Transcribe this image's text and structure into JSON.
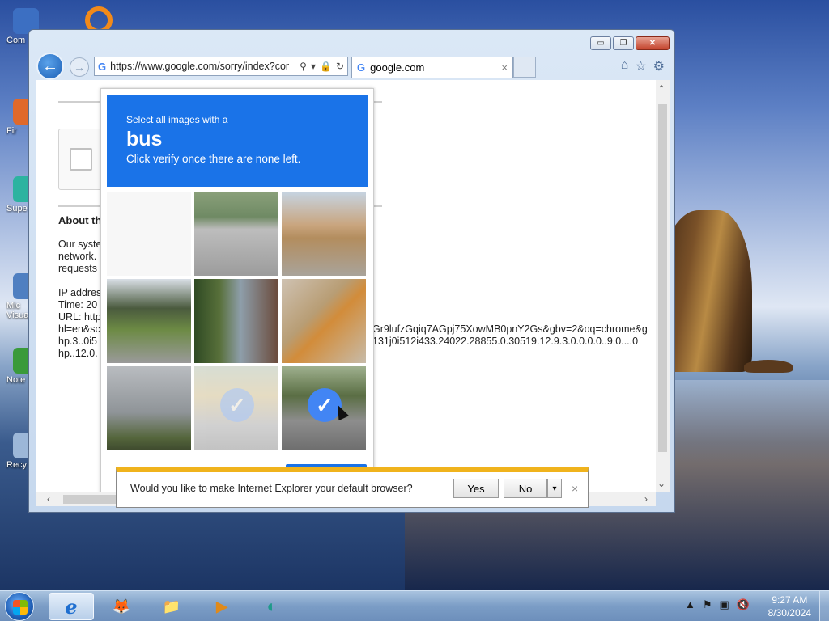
{
  "desktop": {
    "icons": [
      {
        "label": "Com",
        "color": "#3c6fc2"
      },
      {
        "label": "Fir",
        "color": "#e0692a"
      },
      {
        "label": "Supe",
        "color": "#2cb3a0"
      },
      {
        "label": "Mic Visua",
        "color": "#4f7fc1"
      },
      {
        "label": "Note",
        "color": "#3a9a3a"
      },
      {
        "label": "Recy",
        "color": "#9cb7d8"
      }
    ]
  },
  "browser": {
    "address_url": "https://www.google.com/sorry/index?cor",
    "address_g": "G",
    "tab_title": "google.com",
    "tab_g": "G",
    "tab_close": "×",
    "back_glyph": "←",
    "fwd_glyph": "→",
    "controls": {
      "minimize": "▭",
      "restore": "❐",
      "close": "✕"
    }
  },
  "page": {
    "about_heading": "About th",
    "lines": [
      "Our syste",
      "network.",
      "requests",
      "",
      "IP addres",
      "Time: 20",
      "URL: http",
      "hl=en&sc",
      "hp.3..0i5",
      "hp..12.0."
    ],
    "url_tail_1": "Gr9lufzGqiq7AGpj75XowMB0pnY2Gs&gbv=2&oq=chrome&g",
    "url_tail_2": "131j0i512i433.24022.28855.0.30519.12.9.3.0.0.0.0..9.0....0"
  },
  "captcha": {
    "select_line": "Select all images with a",
    "target": "bus",
    "instruction": "Click verify once there are none left.",
    "check_glyph": "✓"
  },
  "notification": {
    "message": "Would you like to make Internet Explorer your default browser?",
    "yes": "Yes",
    "no": "No",
    "dropdown": "▾",
    "close": "×"
  },
  "taskbar": {
    "items": [
      {
        "name": "internet-explorer",
        "glyph": "e"
      },
      {
        "name": "firefox",
        "glyph": "🦊"
      },
      {
        "name": "file-explorer",
        "glyph": "📁"
      },
      {
        "name": "media-player",
        "glyph": "▶"
      },
      {
        "name": "app",
        "glyph": "◐"
      }
    ],
    "time": "9:27 AM",
    "date": "8/30/2024"
  }
}
